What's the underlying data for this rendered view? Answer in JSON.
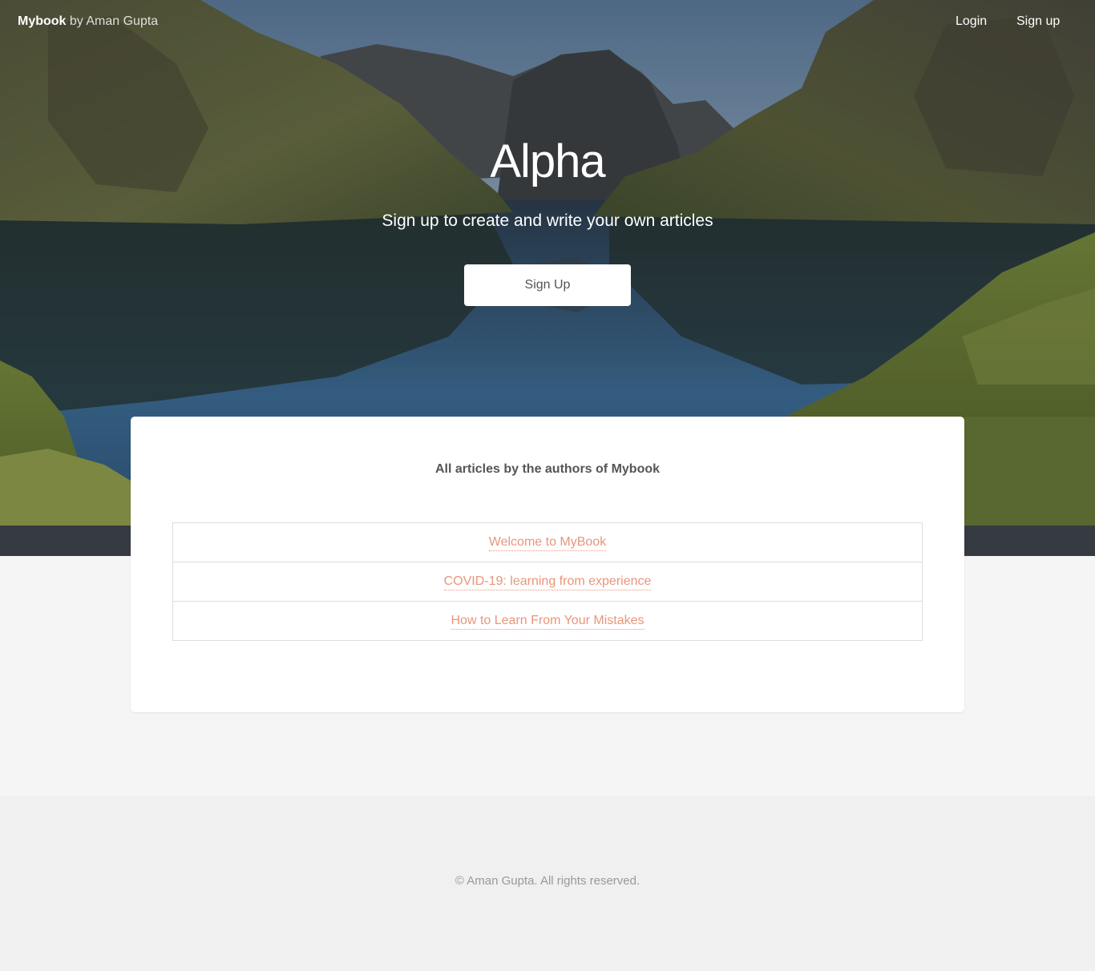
{
  "header": {
    "brand_name": "Mybook",
    "brand_by": "by Aman Gupta",
    "nav": {
      "login_label": "Login",
      "signup_label": "Sign up"
    }
  },
  "hero": {
    "title": "Alpha",
    "subtitle": "Sign up to create and write your own articles",
    "button_label": "Sign Up"
  },
  "articles": {
    "heading": "All articles by the authors of Mybook",
    "items": [
      {
        "title": "Welcome to MyBook"
      },
      {
        "title": "COVID-19: learning from experience"
      },
      {
        "title": "How to Learn From Your Mistakes"
      }
    ],
    "link_color": "#e8967a"
  },
  "footer": {
    "copyright": "© Aman Gupta. All rights reserved."
  }
}
